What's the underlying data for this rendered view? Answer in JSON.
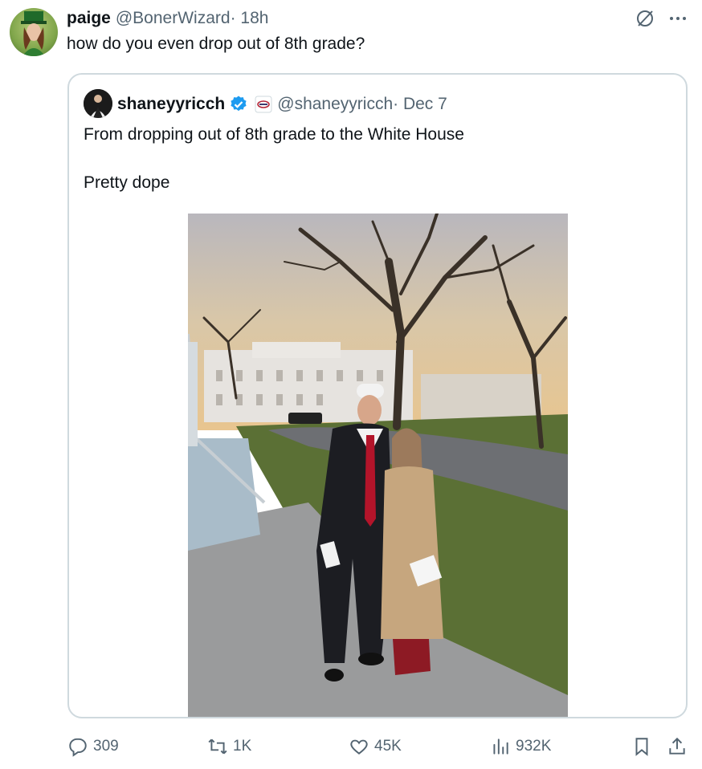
{
  "tweet": {
    "author_name": "paige",
    "author_handle": "@BonerWizard",
    "time": " · 18h",
    "text": "how do you even drop out of 8th grade?"
  },
  "quoted": {
    "author_name": "shaneyyricch",
    "author_handle": "@shaneyyricch",
    "time": " · Dec 7",
    "line1": "From dropping out of 8th grade to the White House",
    "line2": "Pretty dope"
  },
  "actions": {
    "replies": "309",
    "reposts": "1K",
    "likes": "45K",
    "views": "932K"
  },
  "icons": [
    "no-sign-icon",
    "more-icon",
    "verified-icon",
    "org-badge-icon",
    "reply-icon",
    "repost-icon",
    "like-icon",
    "views-icon",
    "bookmark-icon",
    "share-icon"
  ],
  "colors": {
    "verified": "#1d9bf0",
    "secondary_text": "#536471",
    "border": "#cfd9de"
  }
}
